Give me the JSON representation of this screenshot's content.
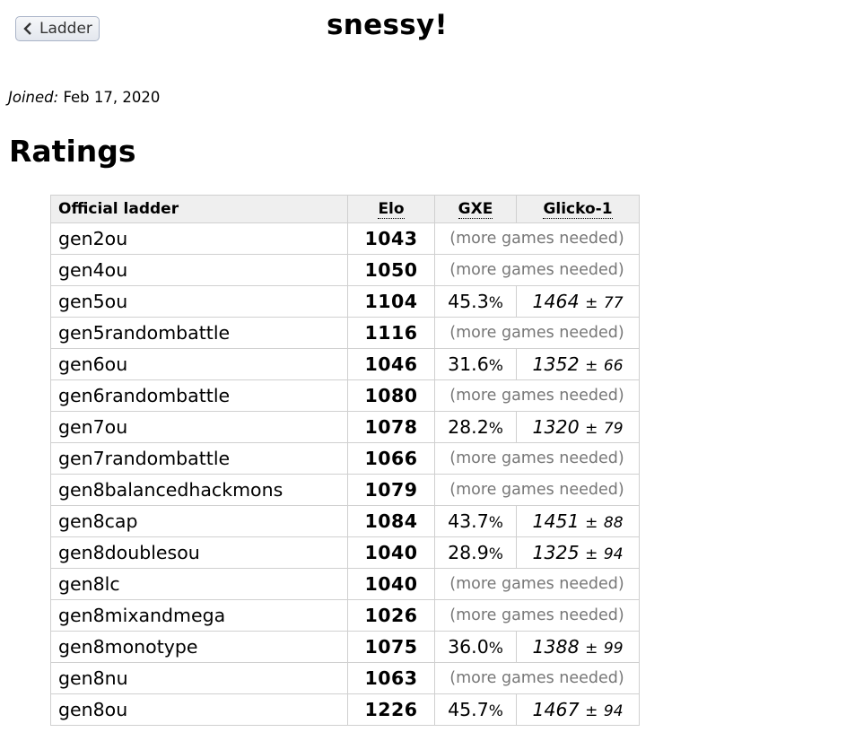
{
  "back_button": {
    "label": "Ladder"
  },
  "user": {
    "name": "snessy!",
    "joined_label": "Joined:",
    "joined_date": "Feb 17, 2020"
  },
  "ratings_heading": "Ratings",
  "table": {
    "headers": {
      "format": "Official ladder",
      "elo": "Elo",
      "gxe": "GXE",
      "glicko": "Glicko-1"
    },
    "more_games_text": "(more games needed)",
    "rows": [
      {
        "format": "gen2ou",
        "elo": "1043"
      },
      {
        "format": "gen4ou",
        "elo": "1050"
      },
      {
        "format": "gen5ou",
        "elo": "1104",
        "gxe": "45.3",
        "gxe_unit": "%",
        "glicko": "1464",
        "pm": "±",
        "dev": "77"
      },
      {
        "format": "gen5randombattle",
        "elo": "1116"
      },
      {
        "format": "gen6ou",
        "elo": "1046",
        "gxe": "31.6",
        "gxe_unit": "%",
        "glicko": "1352",
        "pm": "±",
        "dev": "66"
      },
      {
        "format": "gen6randombattle",
        "elo": "1080"
      },
      {
        "format": "gen7ou",
        "elo": "1078",
        "gxe": "28.2",
        "gxe_unit": "%",
        "glicko": "1320",
        "pm": "±",
        "dev": "79"
      },
      {
        "format": "gen7randombattle",
        "elo": "1066"
      },
      {
        "format": "gen8balancedhackmons",
        "elo": "1079"
      },
      {
        "format": "gen8cap",
        "elo": "1084",
        "gxe": "43.7",
        "gxe_unit": "%",
        "glicko": "1451",
        "pm": "±",
        "dev": "88"
      },
      {
        "format": "gen8doublesou",
        "elo": "1040",
        "gxe": "28.9",
        "gxe_unit": "%",
        "glicko": "1325",
        "pm": "±",
        "dev": "94"
      },
      {
        "format": "gen8lc",
        "elo": "1040"
      },
      {
        "format": "gen8mixandmega",
        "elo": "1026"
      },
      {
        "format": "gen8monotype",
        "elo": "1075",
        "gxe": "36.0",
        "gxe_unit": "%",
        "glicko": "1388",
        "pm": "±",
        "dev": "99"
      },
      {
        "format": "gen8nu",
        "elo": "1063"
      },
      {
        "format": "gen8ou",
        "elo": "1226",
        "gxe": "45.7",
        "gxe_unit": "%",
        "glicko": "1467",
        "pm": "±",
        "dev": "94"
      }
    ]
  }
}
